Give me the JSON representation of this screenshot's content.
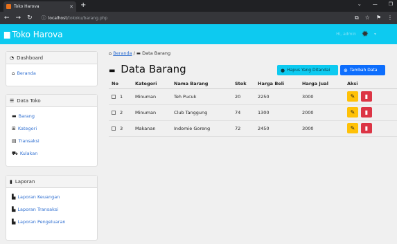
{
  "browser": {
    "tab_title": "Toko Harova",
    "url_host": "localhost",
    "url_path": "/tokoku/barang.php"
  },
  "navbar": {
    "brand": "Toko Harova",
    "user_name": "Hi, admin"
  },
  "sidebar": {
    "dashboard": {
      "title": "Dashboard",
      "items": [
        {
          "label": "Beranda"
        }
      ]
    },
    "data_toko": {
      "title": "Data Toko",
      "items": [
        {
          "label": "Barang"
        },
        {
          "label": "Kategori"
        },
        {
          "label": "Transaksi"
        },
        {
          "label": "Kulakan"
        }
      ]
    },
    "laporan": {
      "title": "Laporan",
      "items": [
        {
          "label": "Laporan Keuangan"
        },
        {
          "label": "Laporan Transaksi"
        },
        {
          "label": "Laporan Pengeluaran"
        }
      ]
    }
  },
  "breadcrumb": {
    "home": "Beranda",
    "separator": "/",
    "current": "Data Barang"
  },
  "page_title": "Data Barang",
  "buttons": {
    "delete_selected": "Hapus Yang Ditandai",
    "add": "Tambah Data"
  },
  "table": {
    "headers": [
      "No",
      "Kategori",
      "Nama Barang",
      "Stok",
      "Harga Beli",
      "Harga Jual",
      "Aksi"
    ],
    "rows": [
      {
        "no": "1",
        "kategori": "Minuman",
        "nama": "Teh Pucuk",
        "stok": "20",
        "harga_beli": "2250",
        "harga_jual": "3000"
      },
      {
        "no": "2",
        "kategori": "Minuman",
        "nama": "Club Tanggung",
        "stok": "74",
        "harga_beli": "1300",
        "harga_jual": "2000"
      },
      {
        "no": "3",
        "kategori": "Makanan",
        "nama": "Indomie Goreng",
        "stok": "72",
        "harga_beli": "2450",
        "harga_jual": "3000"
      }
    ]
  },
  "colors": {
    "navbar": "#0dcaf0",
    "primary": "#0d6efd",
    "warning": "#ffc107",
    "danger": "#dc3545"
  }
}
